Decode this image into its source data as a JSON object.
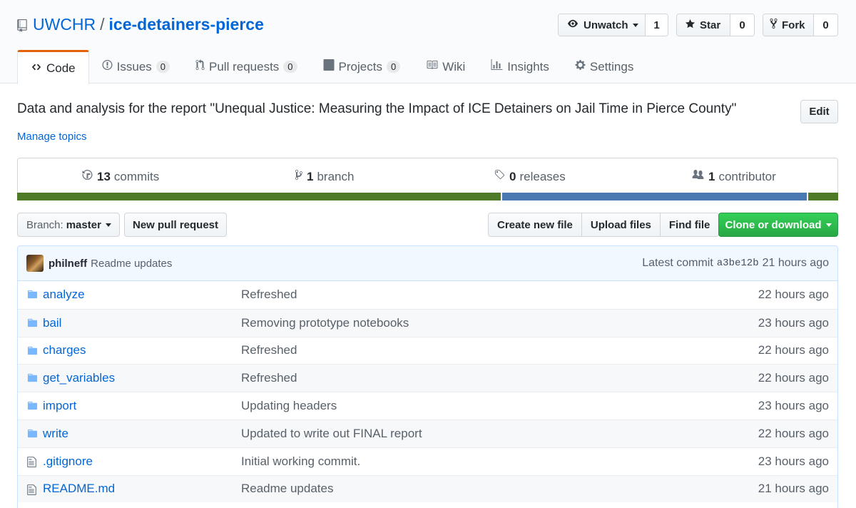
{
  "repo": {
    "owner": "UWCHR",
    "separator": "/",
    "name": "ice-detainers-pierce"
  },
  "actions": {
    "watch": {
      "label": "Unwatch",
      "count": "1",
      "icon": "eye-icon"
    },
    "star": {
      "label": "Star",
      "count": "0",
      "icon": "star-icon"
    },
    "fork": {
      "label": "Fork",
      "count": "0",
      "icon": "fork-icon"
    }
  },
  "tabs": [
    {
      "label": "Code",
      "counter": null,
      "icon": "code-icon",
      "selected": true
    },
    {
      "label": "Issues",
      "counter": "0",
      "icon": "issue-icon"
    },
    {
      "label": "Pull requests",
      "counter": "0",
      "icon": "pull-request-icon"
    },
    {
      "label": "Projects",
      "counter": "0",
      "icon": "project-icon"
    },
    {
      "label": "Wiki",
      "counter": null,
      "icon": "book-icon"
    },
    {
      "label": "Insights",
      "counter": null,
      "icon": "graph-icon"
    },
    {
      "label": "Settings",
      "counter": null,
      "icon": "gear-icon"
    }
  ],
  "description": {
    "text": "Data and analysis for the report \"Unequal Justice: Measuring the Impact of ICE Detainers on Jail Time in Pierce County\"",
    "edit_label": "Edit",
    "topics_label": "Manage topics"
  },
  "summary": {
    "commits": {
      "count": "13",
      "label": "commits"
    },
    "branches": {
      "count": "1",
      "label": "branch"
    },
    "releases": {
      "count": "0",
      "label": "releases"
    },
    "contributors": {
      "count": "1",
      "label": "contributor"
    }
  },
  "language_bar": [
    {
      "color": "#4f7a28",
      "fraction": 0.589
    },
    {
      "color": "#4a78b0",
      "fraction": 0.373
    },
    {
      "color": "#4f7a28",
      "fraction": 0.038
    }
  ],
  "file_nav": {
    "branch_prefix": "Branch:",
    "branch_name": "master",
    "new_pr_label": "New pull request",
    "create_file_label": "Create new file",
    "upload_label": "Upload files",
    "find_label": "Find file",
    "clone_label": "Clone or download"
  },
  "latest_commit": {
    "author": "philneff",
    "message": "Readme updates",
    "prefix": "Latest commit",
    "sha": "a3be12b",
    "age": "21 hours ago"
  },
  "files": [
    {
      "name": "analyze",
      "type": "dir",
      "message": "Refreshed",
      "age": "22 hours ago"
    },
    {
      "name": "bail",
      "type": "dir",
      "message": "Removing prototype notebooks",
      "age": "23 hours ago"
    },
    {
      "name": "charges",
      "type": "dir",
      "message": "Refreshed",
      "age": "22 hours ago"
    },
    {
      "name": "get_variables",
      "type": "dir",
      "message": "Refreshed",
      "age": "22 hours ago"
    },
    {
      "name": "import",
      "type": "dir",
      "message": "Updating headers",
      "age": "23 hours ago"
    },
    {
      "name": "write",
      "type": "dir",
      "message": "Updated to write out FINAL report",
      "age": "22 hours ago"
    },
    {
      "name": ".gitignore",
      "type": "file",
      "message": "Initial working commit.",
      "age": "23 hours ago"
    },
    {
      "name": "README.md",
      "type": "file",
      "message": "Readme updates",
      "age": "21 hours ago"
    }
  ]
}
